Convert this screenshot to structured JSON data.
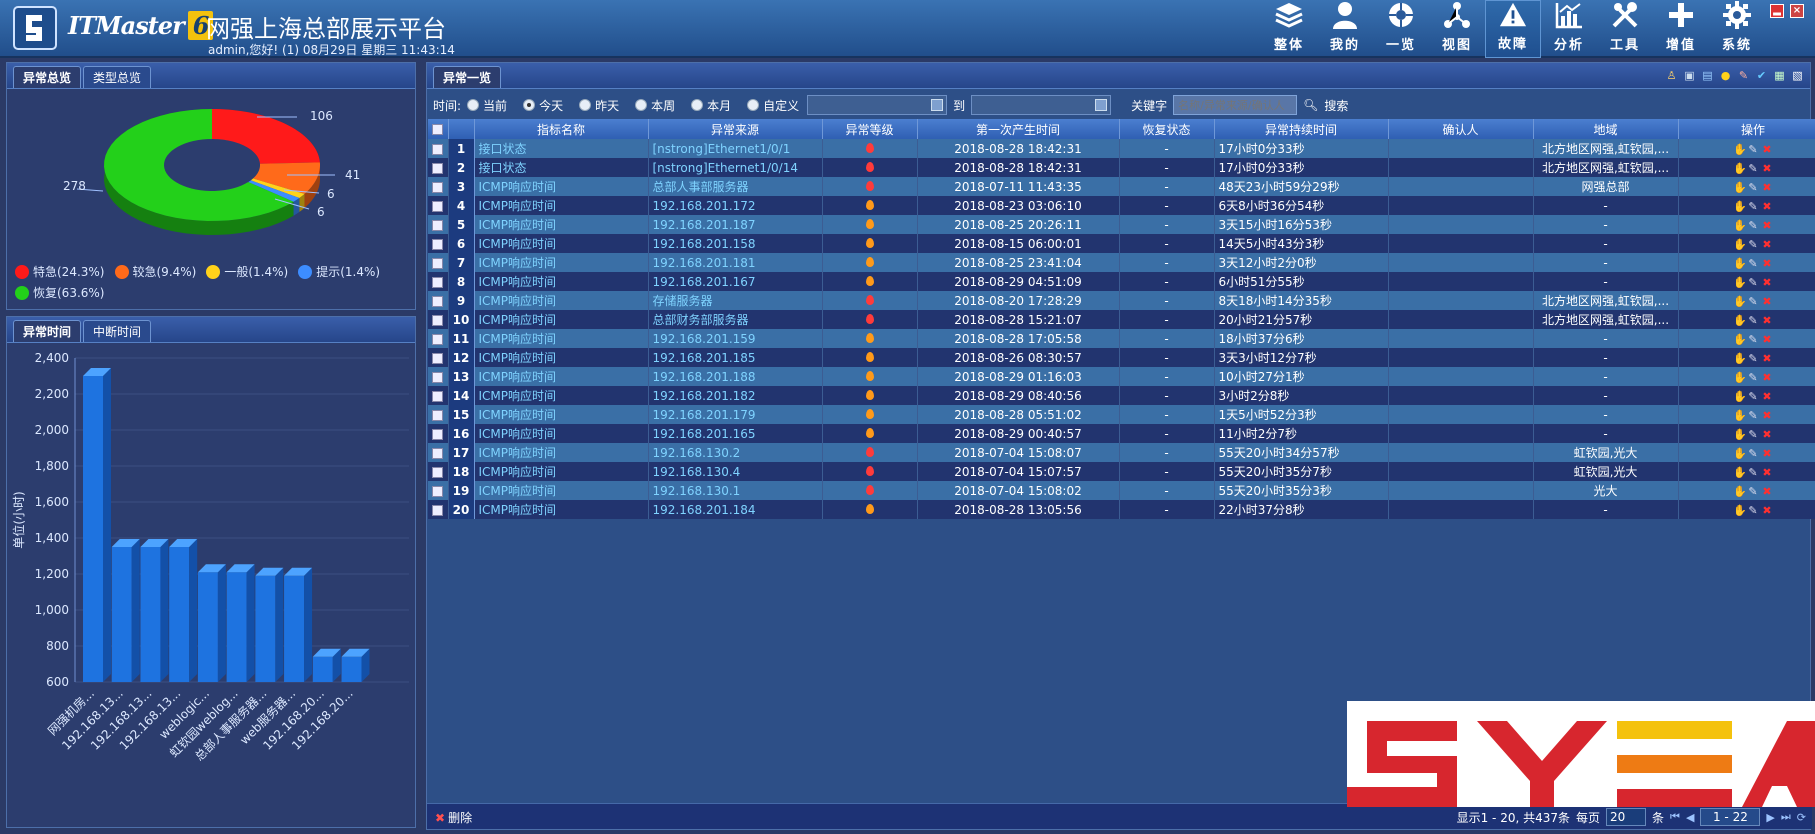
{
  "header": {
    "brand": "ITMaster",
    "brand_version": "6",
    "title": "网强上海总部展示平台",
    "user_info": "admin,您好! (1) 08月29日 星期三 11:43:14"
  },
  "nav": [
    {
      "label": "整体",
      "icon": "stack-icon",
      "active": false
    },
    {
      "label": "我的",
      "icon": "user-icon",
      "active": false
    },
    {
      "label": "一览",
      "icon": "globe-icon",
      "active": false
    },
    {
      "label": "视图",
      "icon": "topology-icon",
      "active": false
    },
    {
      "label": "故障",
      "icon": "warning-icon",
      "active": true
    },
    {
      "label": "分析",
      "icon": "chart-icon",
      "active": false
    },
    {
      "label": "工具",
      "icon": "tools-icon",
      "active": false
    },
    {
      "label": "增值",
      "icon": "plus-icon",
      "active": false
    },
    {
      "label": "系统",
      "icon": "gear-icon",
      "active": false
    }
  ],
  "left_top": {
    "tabs": [
      "异常总览",
      "类型总览"
    ],
    "chart_data": {
      "type": "pie",
      "slices": [
        {
          "name": "特急",
          "value": 106,
          "percent": "24.3%",
          "color": "#ff1a1a"
        },
        {
          "name": "较急",
          "value": 41,
          "percent": "9.4%",
          "color": "#ff6a1a"
        },
        {
          "name": "一般",
          "value": 6,
          "percent": "1.4%",
          "color": "#ffd21a"
        },
        {
          "name": "提示",
          "value": 6,
          "percent": "1.4%",
          "color": "#3d8dff"
        },
        {
          "name": "恢复",
          "value": 278,
          "percent": "63.6%",
          "color": "#23d01a"
        }
      ],
      "legend": [
        "特急(24.3%)",
        "较急(9.4%)",
        "一般(1.4%)",
        "提示(1.4%)",
        "恢复(63.6%)"
      ]
    }
  },
  "left_bottom": {
    "tabs": [
      "异常时间",
      "中断时间"
    ],
    "chart_data": {
      "type": "bar",
      "ylabel": "单位(小时)",
      "ylim": [
        600,
        2400
      ],
      "yticks": [
        "600",
        "800",
        "1,000",
        "1,200",
        "1,400",
        "1,600",
        "1,800",
        "2,000",
        "2,200",
        "2,400"
      ],
      "categories": [
        "网强机房...",
        "192.168.13...",
        "192.168.13...",
        "192.168.13...",
        "weblogic...",
        "虹钦园weblog...",
        "总部人事服务器...",
        "web服务器...",
        "192.168.20...",
        "192.168.20..."
      ],
      "values": [
        2300,
        1350,
        1350,
        1350,
        1210,
        1210,
        1190,
        1190,
        740,
        740
      ]
    }
  },
  "main": {
    "tab": "异常一览",
    "filter": {
      "time_label": "时间:",
      "options": [
        "当前",
        "今天",
        "昨天",
        "本周",
        "本月",
        "自定义"
      ],
      "selected": "今天",
      "to_label": "到",
      "keyword_label": "关键字",
      "keyword_placeholder": "名称/异常来源/确认人",
      "search_label": "搜索"
    },
    "columns": [
      "指标名称",
      "异常来源",
      "异常等级",
      "第一次产生时间",
      "恢复状态",
      "异常持续时间",
      "确认人",
      "地域",
      "操作"
    ],
    "rows": [
      {
        "no": "1",
        "name": "接口状态",
        "source": "[nstrong]Ethernet1/0/1",
        "level": "red",
        "time": "2018-08-28 18:42:31",
        "recover": "-",
        "duration": "17小时0分33秒",
        "confirm": "",
        "region": "北方地区网强,虹钦园,..."
      },
      {
        "no": "2",
        "name": "接口状态",
        "source": "[nstrong]Ethernet1/0/14",
        "level": "red",
        "time": "2018-08-28 18:42:31",
        "recover": "-",
        "duration": "17小时0分33秒",
        "confirm": "",
        "region": "北方地区网强,虹钦园,..."
      },
      {
        "no": "3",
        "name": "ICMP响应时间",
        "source": "总部人事部服务器",
        "level": "red",
        "time": "2018-07-11 11:43:35",
        "recover": "-",
        "duration": "48天23小时59分29秒",
        "confirm": "",
        "region": "网强总部"
      },
      {
        "no": "4",
        "name": "ICMP响应时间",
        "source": "192.168.201.172",
        "level": "orange",
        "time": "2018-08-23 03:06:10",
        "recover": "-",
        "duration": "6天8小时36分54秒",
        "confirm": "",
        "region": "-"
      },
      {
        "no": "5",
        "name": "ICMP响应时间",
        "source": "192.168.201.187",
        "level": "orange",
        "time": "2018-08-25 20:26:11",
        "recover": "-",
        "duration": "3天15小时16分53秒",
        "confirm": "",
        "region": "-"
      },
      {
        "no": "6",
        "name": "ICMP响应时间",
        "source": "192.168.201.158",
        "level": "orange",
        "time": "2018-08-15 06:00:01",
        "recover": "-",
        "duration": "14天5小时43分3秒",
        "confirm": "",
        "region": "-"
      },
      {
        "no": "7",
        "name": "ICMP响应时间",
        "source": "192.168.201.181",
        "level": "orange",
        "time": "2018-08-25 23:41:04",
        "recover": "-",
        "duration": "3天12小时2分0秒",
        "confirm": "",
        "region": "-"
      },
      {
        "no": "8",
        "name": "ICMP响应时间",
        "source": "192.168.201.167",
        "level": "orange",
        "time": "2018-08-29 04:51:09",
        "recover": "-",
        "duration": "6小时51分55秒",
        "confirm": "",
        "region": "-"
      },
      {
        "no": "9",
        "name": "ICMP响应时间",
        "source": "存储服务器",
        "level": "red",
        "time": "2018-08-20 17:28:29",
        "recover": "-",
        "duration": "8天18小时14分35秒",
        "confirm": "",
        "region": "北方地区网强,虹钦园,..."
      },
      {
        "no": "10",
        "name": "ICMP响应时间",
        "source": "总部财务部服务器",
        "level": "red",
        "time": "2018-08-28 15:21:07",
        "recover": "-",
        "duration": "20小时21分57秒",
        "confirm": "",
        "region": "北方地区网强,虹钦园,..."
      },
      {
        "no": "11",
        "name": "ICMP响应时间",
        "source": "192.168.201.159",
        "level": "orange",
        "time": "2018-08-28 17:05:58",
        "recover": "-",
        "duration": "18小时37分6秒",
        "confirm": "",
        "region": "-"
      },
      {
        "no": "12",
        "name": "ICMP响应时间",
        "source": "192.168.201.185",
        "level": "orange",
        "time": "2018-08-26 08:30:57",
        "recover": "-",
        "duration": "3天3小时12分7秒",
        "confirm": "",
        "region": "-"
      },
      {
        "no": "13",
        "name": "ICMP响应时间",
        "source": "192.168.201.188",
        "level": "orange",
        "time": "2018-08-29 01:16:03",
        "recover": "-",
        "duration": "10小时27分1秒",
        "confirm": "",
        "region": "-"
      },
      {
        "no": "14",
        "name": "ICMP响应时间",
        "source": "192.168.201.182",
        "level": "orange",
        "time": "2018-08-29 08:40:56",
        "recover": "-",
        "duration": "3小时2分8秒",
        "confirm": "",
        "region": "-"
      },
      {
        "no": "15",
        "name": "ICMP响应时间",
        "source": "192.168.201.179",
        "level": "orange",
        "time": "2018-08-28 05:51:02",
        "recover": "-",
        "duration": "1天5小时52分3秒",
        "confirm": "",
        "region": "-"
      },
      {
        "no": "16",
        "name": "ICMP响应时间",
        "source": "192.168.201.165",
        "level": "orange",
        "time": "2018-08-29 00:40:57",
        "recover": "-",
        "duration": "11小时2分7秒",
        "confirm": "",
        "region": "-"
      },
      {
        "no": "17",
        "name": "ICMP响应时间",
        "source": "192.168.130.2",
        "level": "red",
        "time": "2018-07-04 15:08:07",
        "recover": "-",
        "duration": "55天20小时34分57秒",
        "confirm": "",
        "region": "虹钦园,光大"
      },
      {
        "no": "18",
        "name": "ICMP响应时间",
        "source": "192.168.130.4",
        "level": "red",
        "time": "2018-07-04 15:07:57",
        "recover": "-",
        "duration": "55天20小时35分7秒",
        "confirm": "",
        "region": "虹钦园,光大"
      },
      {
        "no": "19",
        "name": "ICMP响应时间",
        "source": "192.168.130.1",
        "level": "red",
        "time": "2018-07-04 15:08:02",
        "recover": "-",
        "duration": "55天20小时35分3秒",
        "confirm": "",
        "region": "光大"
      },
      {
        "no": "20",
        "name": "ICMP响应时间",
        "source": "192.168.201.184",
        "level": "orange",
        "time": "2018-08-28 13:05:56",
        "recover": "-",
        "duration": "22小时37分8秒",
        "confirm": "",
        "region": "-"
      }
    ],
    "footer": {
      "delete_label": "删除",
      "display_info": "显示1 - 20, 共437条",
      "per_page_label": "每页",
      "per_page_value": "20",
      "unit": "条",
      "page_range": "1 - 22"
    }
  },
  "watermark": {
    "text": "SYEA"
  },
  "colors": {
    "level_red": "#ff3b3b",
    "level_orange": "#ff9a1a",
    "link": "#7fd3ff"
  }
}
